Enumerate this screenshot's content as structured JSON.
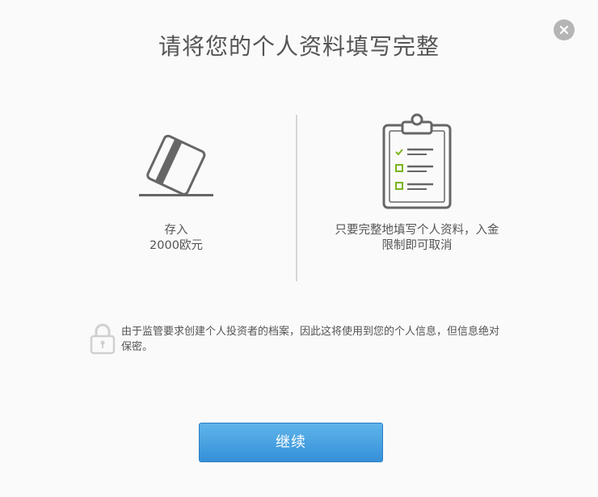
{
  "dialog": {
    "title": "请将您的个人资料填写完整"
  },
  "left_panel": {
    "line1": "存入",
    "line2": "2000欧元",
    "icon": "credit-card-icon"
  },
  "right_panel": {
    "line1": "只要完整地填写个人资料，入金",
    "line2": "限制即可取消",
    "icon": "clipboard-checklist-icon"
  },
  "notice": {
    "text": "由于监管要求创建个人投资者的档案，因此这将使用到您的个人信息，但信息绝对保密。",
    "icon": "lock-icon"
  },
  "actions": {
    "continue_label": "继续"
  },
  "colors": {
    "accent": "#3a93da",
    "check_green": "#7ab51d"
  }
}
